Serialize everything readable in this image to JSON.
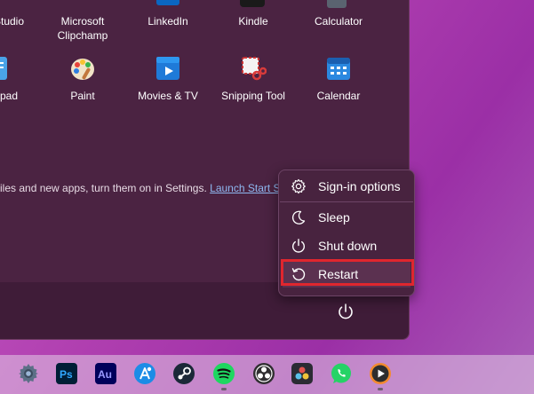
{
  "start_menu": {
    "top_row_apps": [
      {
        "label": "Studio",
        "icon": "studio-icon"
      },
      {
        "label": "Microsoft\nClipchamp",
        "icon": "clipchamp-icon"
      },
      {
        "label": "LinkedIn",
        "icon": "linkedin-icon"
      },
      {
        "label": "Kindle",
        "icon": "kindle-icon"
      },
      {
        "label": "Calculator",
        "icon": "calculator-icon"
      }
    ],
    "second_row_apps": [
      {
        "label": "pad",
        "icon": "notepad-icon"
      },
      {
        "label": "Paint",
        "icon": "paint-icon"
      },
      {
        "label": "Movies & TV",
        "icon": "movies-tv-icon"
      },
      {
        "label": "Snipping Tool",
        "icon": "snipping-tool-icon"
      },
      {
        "label": "Calendar",
        "icon": "calendar-icon"
      }
    ],
    "recommended_hint": "iles and new apps, turn them on in Settings.",
    "recommended_link": "Launch Start S"
  },
  "power_menu": {
    "items": [
      {
        "label": "Sign-in options",
        "icon": "gear-icon"
      },
      {
        "label": "Sleep",
        "icon": "moon-icon"
      },
      {
        "label": "Shut down",
        "icon": "power-icon"
      },
      {
        "label": "Restart",
        "icon": "restart-icon"
      }
    ],
    "highlighted_item": "Restart",
    "highlight_color": "#e0262e"
  },
  "taskbar": {
    "icons": [
      {
        "name": "settings-icon",
        "running": false
      },
      {
        "name": "photoshop-icon",
        "text": "Ps",
        "running": false
      },
      {
        "name": "audition-icon",
        "text": "Au",
        "running": false
      },
      {
        "name": "copilot-icon",
        "running": false
      },
      {
        "name": "steam-icon",
        "running": false
      },
      {
        "name": "spotify-icon",
        "running": true
      },
      {
        "name": "obs-icon",
        "running": false
      },
      {
        "name": "davinci-resolve-icon",
        "running": false
      },
      {
        "name": "whatsapp-icon",
        "running": false
      },
      {
        "name": "media-player-icon",
        "running": true
      }
    ]
  }
}
